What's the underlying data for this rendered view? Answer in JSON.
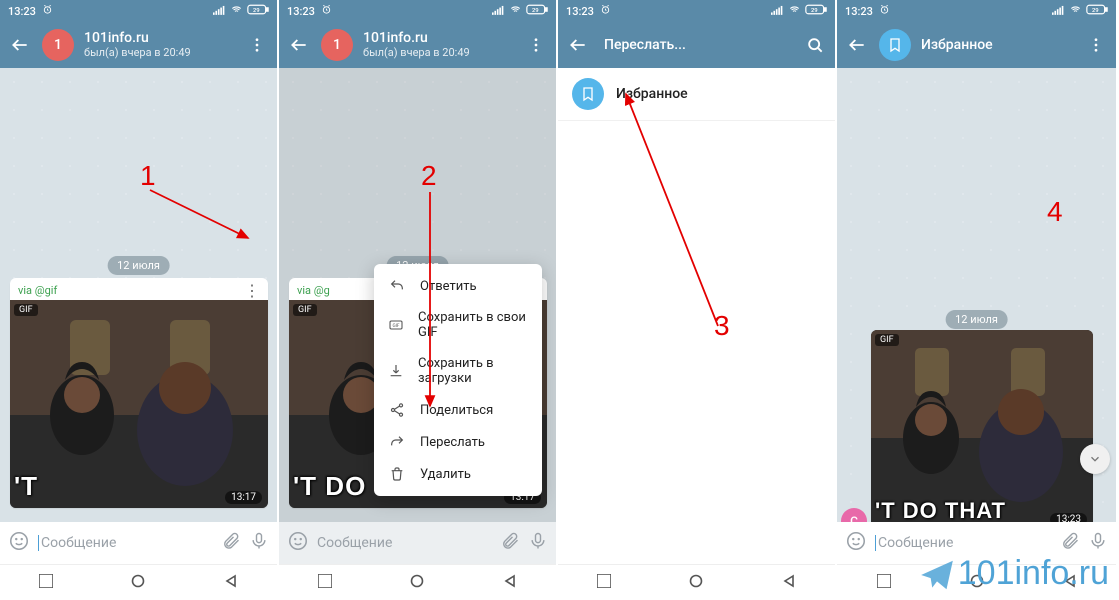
{
  "status": {
    "time": "13:23"
  },
  "screens": {
    "s1": {
      "header": {
        "title": "101info.ru",
        "subtitle": "был(а) вчера в 20:49",
        "avatar_letter": "1"
      },
      "date_chip": "12 июля",
      "via_label": "via @gif",
      "gif_badge": "GIF",
      "msg_time": "13:17",
      "meme_text": "'T",
      "input_placeholder": "Сообщение"
    },
    "s2": {
      "header": {
        "title": "101info.ru",
        "subtitle": "был(а) вчера в 20:49",
        "avatar_letter": "1"
      },
      "date_chip": "12 июля",
      "via_label": "via @g",
      "gif_badge": "GIF",
      "msg_time": "13:17",
      "meme_text": "'T DO",
      "menu": {
        "reply": "Ответить",
        "save_gif": "Сохранить в свои GIF",
        "save_downloads": "Сохранить в загрузки",
        "share": "Поделиться",
        "forward": "Переслать",
        "delete": "Удалить"
      },
      "input_placeholder": "Сообщение"
    },
    "s3": {
      "header": {
        "title": "Переслать..."
      },
      "list_item": {
        "name": "Избранное"
      }
    },
    "s4": {
      "header": {
        "title": "Избранное"
      },
      "date_chip": "12 июля",
      "gif_badge": "GIF",
      "msg_time": "13:23",
      "meme_text": "'T DO THAT",
      "avatar_mini": "С",
      "input_placeholder": "Сообщение"
    }
  },
  "annotations": {
    "n1": "1",
    "n2": "2",
    "n3": "3",
    "n4": "4"
  },
  "watermark": "101info.ru"
}
